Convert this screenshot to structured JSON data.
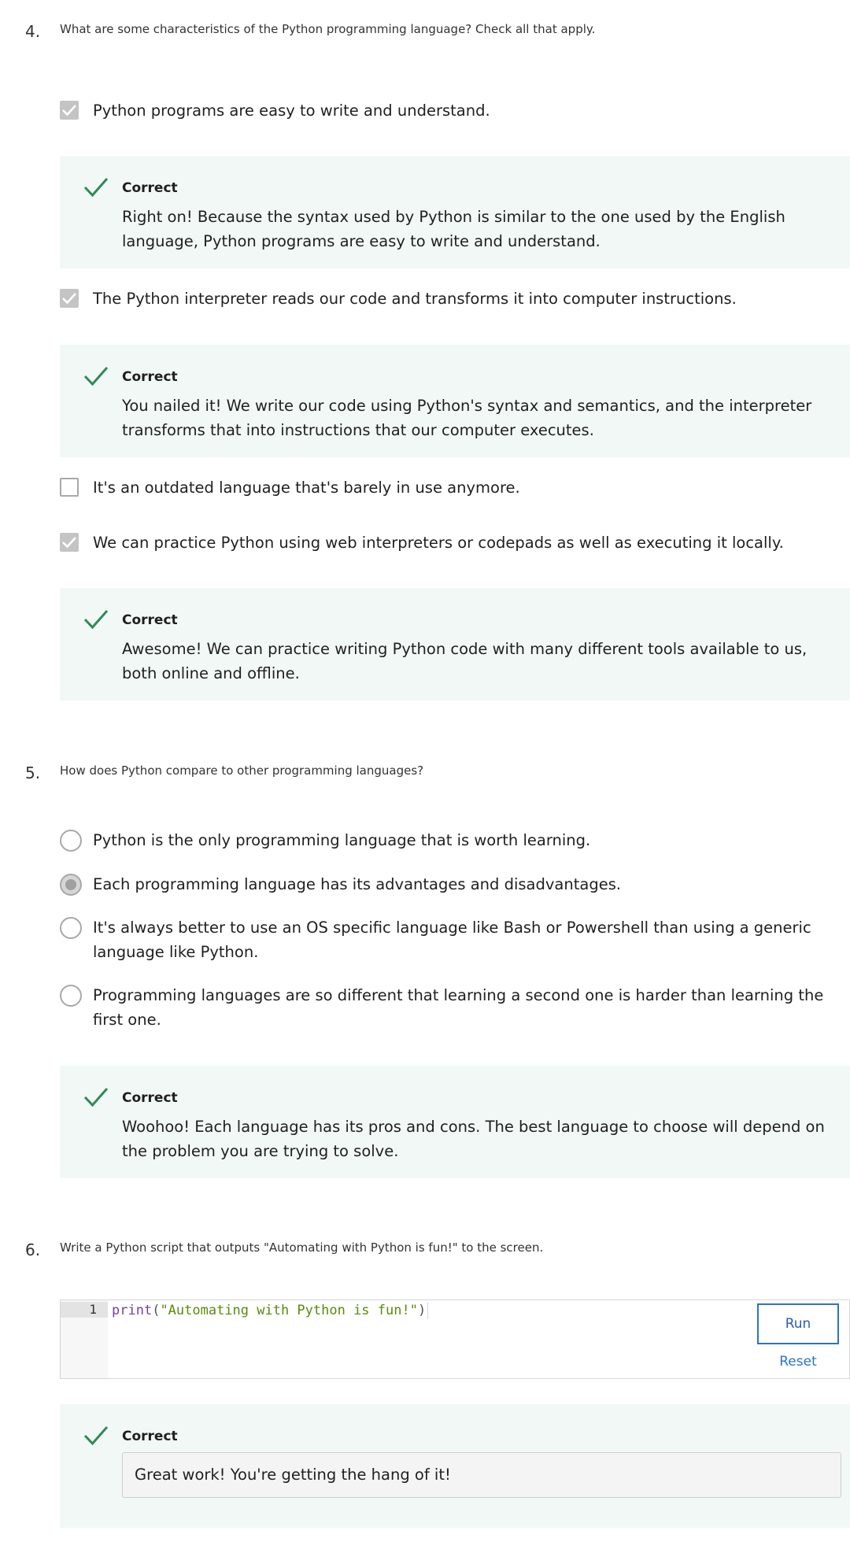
{
  "colors": {
    "correct_green": "#2e8b57",
    "feedback_bg": "#f2f8f6",
    "checkbox_checked": "#c4c4c4",
    "link_blue": "#2a73cc"
  },
  "questions": {
    "q4": {
      "number": "4.",
      "text": "What are some characteristics of the Python programming language? Check all that apply.",
      "options": [
        {
          "label": "Python programs are easy to write and understand.",
          "checked": true
        },
        {
          "label": "The Python interpreter reads our code and transforms it into computer instructions.",
          "checked": true
        },
        {
          "label": "It's an outdated language that's barely in use anymore.",
          "checked": false
        },
        {
          "label": "We can practice Python using web interpreters or codepads as well as executing it locally.",
          "checked": true
        }
      ],
      "feedback": [
        {
          "title": "Correct",
          "text": "Right on! Because the syntax used by Python is similar to the one used by the English language, Python programs are easy to write and understand.",
          "icon": "checkmark-icon"
        },
        {
          "title": "Correct",
          "text": "You nailed it! We write our code using Python's syntax and semantics, and the interpreter transforms that into instructions that our computer executes.",
          "icon": "checkmark-icon"
        },
        {
          "title": "Correct",
          "text": "Awesome! We can practice writing Python code with many different tools available to us, both online and offline.",
          "icon": "checkmark-icon"
        }
      ]
    },
    "q5": {
      "number": "5.",
      "text": "How does Python compare to other programming languages?",
      "options": [
        {
          "label": "Python is the only programming language that is worth learning.",
          "selected": false
        },
        {
          "label": "Each programming language has its advantages and disadvantages.",
          "selected": true
        },
        {
          "label": "It's always better to use an OS specific language like Bash or Powershell than using a generic language like Python.",
          "selected": false
        },
        {
          "label": "Programming languages are so different that learning a second one is harder than learning the first one.",
          "selected": false
        }
      ],
      "feedback": {
        "title": "Correct",
        "text": "Woohoo! Each language has its pros and cons. The best language to choose will depend on the problem you are trying to solve.",
        "icon": "checkmark-icon"
      }
    },
    "q6": {
      "number": "6.",
      "text": "Write a Python script that outputs \"Automating with Python is fun!\" to the screen.",
      "editor": {
        "line_number": "1",
        "code_fn": "print",
        "code_open": "(",
        "code_str": "\"Automating with Python is fun!\"",
        "code_close": ")"
      },
      "run_label": "Run",
      "reset_label": "Reset",
      "feedback": {
        "title": "Correct",
        "text": "Great work! You're getting the hang of it!",
        "icon": "checkmark-icon"
      }
    }
  }
}
